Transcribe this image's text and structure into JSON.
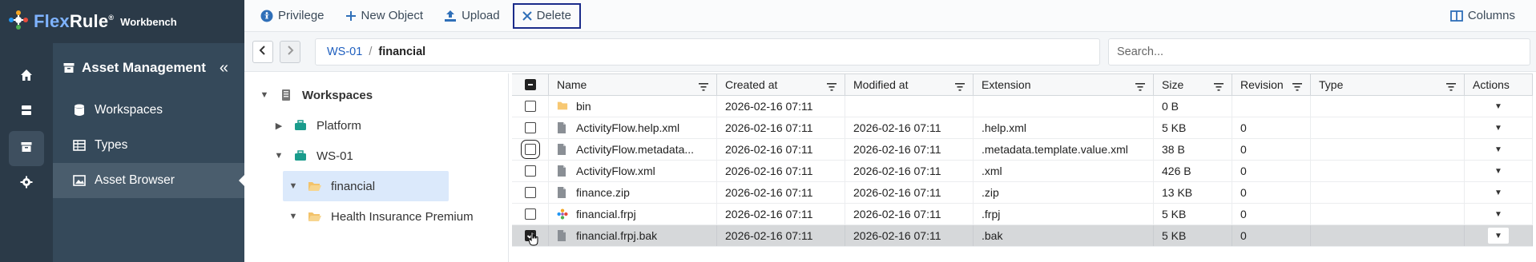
{
  "brand": {
    "name_part1": "Flex",
    "name_part2": "Rule",
    "registered": "®",
    "product": "Workbench"
  },
  "rail": {
    "items": [
      {
        "icon": "home-icon"
      },
      {
        "icon": "server-icon"
      },
      {
        "icon": "archive-icon",
        "active": true
      },
      {
        "icon": "gear-icon"
      }
    ]
  },
  "menu": {
    "title": "Asset Management",
    "collapse_glyph": "«",
    "items": [
      {
        "label": "Workspaces",
        "icon": "database-icon"
      },
      {
        "label": "Types",
        "icon": "table-icon"
      },
      {
        "label": "Asset Browser",
        "icon": "image-icon",
        "selected": true
      }
    ]
  },
  "toolbar": {
    "privilege_label": "Privilege",
    "new_object_label": "New Object",
    "upload_label": "Upload",
    "delete_label": "Delete",
    "columns_label": "Columns"
  },
  "navbar": {
    "breadcrumb_root": "WS-01",
    "breadcrumb_separator": "/",
    "breadcrumb_current": "financial",
    "search_placeholder": "Search..."
  },
  "tree": {
    "nodes": [
      {
        "label": "Workspaces",
        "level": 0,
        "expanded": true,
        "icon": "server-icon",
        "bold": true
      },
      {
        "label": "Platform",
        "level": 1,
        "expanded": false,
        "icon": "briefcase-icon"
      },
      {
        "label": "WS-01",
        "level": 1,
        "expanded": true,
        "icon": "briefcase-icon"
      },
      {
        "label": "financial",
        "level": 2,
        "expanded": true,
        "icon": "folder-icon",
        "selected": true
      },
      {
        "label": "Health Insurance Premium",
        "level": 2,
        "expanded": true,
        "icon": "folder-icon"
      }
    ]
  },
  "grid": {
    "columns": [
      "Name",
      "Created at",
      "Modified at",
      "Extension",
      "Size",
      "Revision",
      "Type",
      "Actions"
    ],
    "rows": [
      {
        "name": "bin",
        "icon": "folder-icon",
        "created": "2026-02-16 07:11",
        "modified": "",
        "extension": "",
        "size": "0 B",
        "revision": "",
        "type": "",
        "checked": false
      },
      {
        "name": "ActivityFlow.help.xml",
        "icon": "file-icon",
        "created": "2026-02-16 07:11",
        "modified": "2026-02-16 07:11",
        "extension": ".help.xml",
        "size": "5 KB",
        "revision": "0",
        "type": "",
        "checked": false
      },
      {
        "name": "ActivityFlow.metadata...",
        "icon": "file-icon",
        "created": "2026-02-16 07:11",
        "modified": "2026-02-16 07:11",
        "extension": ".metadata.template.value.xml",
        "size": "38 B",
        "revision": "0",
        "type": "",
        "checked": false,
        "focused": true
      },
      {
        "name": "ActivityFlow.xml",
        "icon": "file-icon",
        "created": "2026-02-16 07:11",
        "modified": "2026-02-16 07:11",
        "extension": ".xml",
        "size": "426 B",
        "revision": "0",
        "type": "",
        "checked": false
      },
      {
        "name": "finance.zip",
        "icon": "file-icon",
        "created": "2026-02-16 07:11",
        "modified": "2026-02-16 07:11",
        "extension": ".zip",
        "size": "13 KB",
        "revision": "0",
        "type": "",
        "checked": false
      },
      {
        "name": "financial.frpj",
        "icon": "project-icon",
        "created": "2026-02-16 07:11",
        "modified": "2026-02-16 07:11",
        "extension": ".frpj",
        "size": "5 KB",
        "revision": "0",
        "type": "",
        "checked": false
      },
      {
        "name": "financial.frpj.bak",
        "icon": "file-icon",
        "created": "2026-02-16 07:11",
        "modified": "2026-02-16 07:11",
        "extension": ".bak",
        "size": "5 KB",
        "revision": "0",
        "type": "",
        "checked": true,
        "selected": true
      }
    ]
  },
  "colors": {
    "sidebar": "#2b3a48",
    "menu": "#35495a",
    "link": "#1f5fbf",
    "selection": "#dbe9fb",
    "focus_border": "#1a2b8a"
  }
}
